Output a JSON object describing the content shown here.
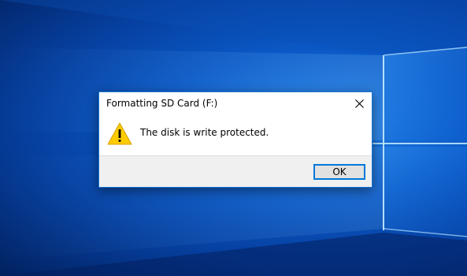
{
  "desktop": {
    "wallpaper": "Windows 10 hero light beams",
    "colors": {
      "deep": "#02215f",
      "mid": "#0a58c6",
      "light": "#1f7fe6"
    }
  },
  "dialog": {
    "title": "Formatting SD Card (F:)",
    "close_icon": "close-icon",
    "message": "The disk is write protected.",
    "icon": "warning-icon",
    "ok_label": "OK",
    "accent": "#0078d7"
  }
}
